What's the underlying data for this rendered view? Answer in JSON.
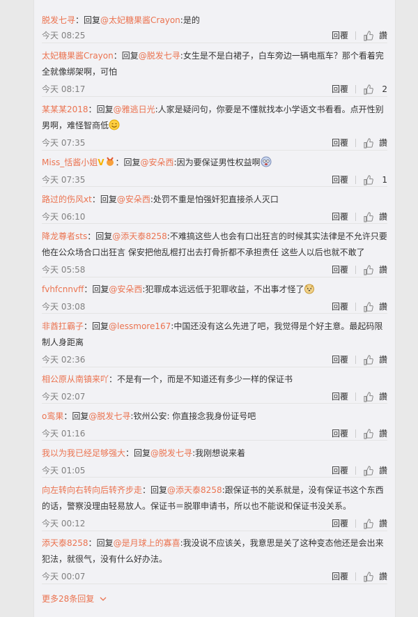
{
  "ui": {
    "reply_label": "回覆",
    "like_label": "讚",
    "sep": "：",
    "reply_prefix": "回复",
    "colon": ":",
    "more_replies": "更多28条回复"
  },
  "comments": [
    {
      "user": "脱发七寻",
      "mention": "@太妃糖果酱Crayon",
      "text": "是的",
      "time": "今天 08:25",
      "likes": "讚"
    },
    {
      "user": "太妃糖果酱Crayon",
      "mention": "@脱发七寻",
      "text": "女生是不是白裙子，白车旁边一辆电瓶车？那个看着完全就像绑架啊，可怕",
      "time": "今天 08:17",
      "likes": "2"
    },
    {
      "user": "某某某2018",
      "mention": "@雅逃日光",
      "text": "人家是疑问句，你要是不懂就找本小学语文书看看。点开性别男啊，难怪智商低",
      "time": "今天 07:35",
      "likes": "讚"
    },
    {
      "user": "Miss_恬酱小姐",
      "mention": "@安朵西",
      "text": "因为要保证男性权益啊",
      "time": "今天 07:35",
      "likes": "1"
    },
    {
      "user": "路过的伤风xt",
      "mention": "@安朵西",
      "text": "处罚不重是怕强奸犯直接杀人灭口",
      "time": "今天 06:10",
      "likes": "讚"
    },
    {
      "user": "降龙尊者sts",
      "mention": "@添天泰8258",
      "text": "不难搞这些人也会有口出狂言的时候其实法律是不允许只要他在公众场合口出狂言 保安把他乱棍打出去打骨折都不承担责任 这些人以后也就不敢了",
      "time": "今天 05:58",
      "likes": "讚"
    },
    {
      "user": "fvhfcnnvff",
      "mention": "@安朵西",
      "text": "犯罪成本远远低于犯罪收益，不出事才怪了",
      "time": "今天 03:08",
      "likes": "讚"
    },
    {
      "user": "非酋扛霸子",
      "mention": "@lessmore167",
      "text": "中国还没有这么先进了吧，我觉得是个好主意。最起码限制人身距离",
      "time": "今天 02:36",
      "likes": "讚"
    },
    {
      "user": "相公原从南镇来吖",
      "mention": "",
      "text": "不是有一个，而是不知道还有多少一样的保证书",
      "time": "今天 02:07",
      "likes": "讚"
    },
    {
      "user": "o鸾果",
      "mention": "@脱发七寻",
      "text": "钦州公安: 你直接念我身份证号吧",
      "time": "今天 01:16",
      "likes": "讚"
    },
    {
      "user": "我以为我已经足够强大",
      "mention": "@脱发七寻",
      "text": "我刚想说来着",
      "time": "今天 01:05",
      "likes": "讚"
    },
    {
      "user": "向左转向右转向后转齐步走",
      "mention": "@添天泰8258",
      "text": "跟保证书的关系就是，没有保证书这个东西的话，警察没理由轻易放人。保证书＝脱罪申请书，所以也不能说和保证书没关系。",
      "time": "今天 00:12",
      "likes": "讚"
    },
    {
      "user": "添天泰8258",
      "mention": "@是月球上的寡喜",
      "text": "我没说不应该关，我意思是关了这种变态他还是会出来犯法，就很气，没有什么好办法。",
      "time": "今天 00:07",
      "likes": "讚"
    }
  ]
}
